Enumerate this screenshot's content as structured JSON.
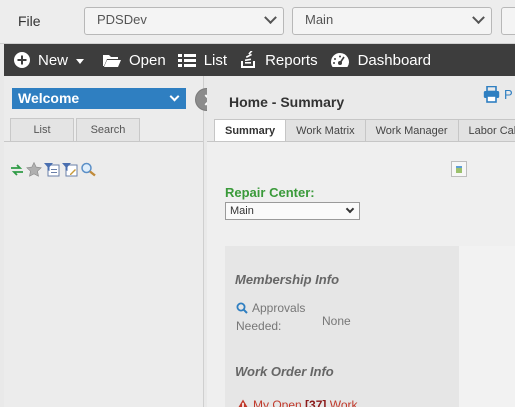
{
  "menu": {
    "file": "File"
  },
  "selectors": {
    "database": "PDSDev",
    "site": "Main"
  },
  "toolbar": {
    "new": "New",
    "open": "Open",
    "list": "List",
    "reports": "Reports",
    "dashboard": "Dashboard"
  },
  "left": {
    "welcome": "Welcome",
    "tabs": [
      "List",
      "Search"
    ],
    "icons": [
      "refresh-icon",
      "star-icon",
      "filter-list-icon",
      "filter-edit-icon",
      "magnify-icon"
    ]
  },
  "main": {
    "title": "Home - Summary",
    "print_label": "P",
    "tabs": [
      "Summary",
      "Work Matrix",
      "Work Manager",
      "Labor Cal"
    ],
    "active_tab": "Summary",
    "repair_center_label": "Repair Center:",
    "repair_center_value": "Main",
    "membership_heading": "Membership Info",
    "approvals_label_1": "Approvals",
    "approvals_label_2": "Needed:",
    "approvals_value": "None",
    "work_order_heading": "Work Order Info",
    "my_open_prefix": "My Open",
    "my_open_count": "[37]",
    "my_open_suffix": "Work"
  },
  "colors": {
    "accent": "#2f7fc1",
    "toolbar_bg": "#3d3d3d",
    "repair_label": "#3a9a3a",
    "alert": "#c0392b"
  }
}
